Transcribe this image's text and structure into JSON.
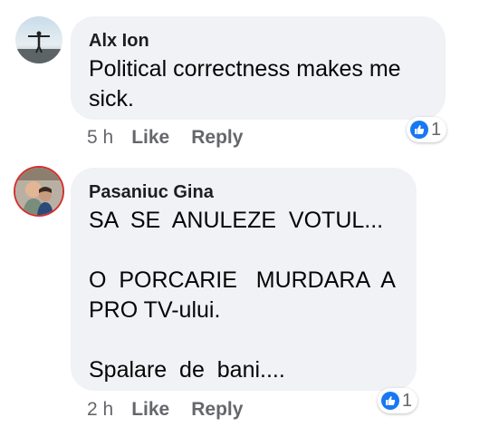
{
  "comments": [
    {
      "author": "Alx Ion",
      "text": "Political correctness makes me\nsick.",
      "time": "5 h",
      "like_label": "Like",
      "reply_label": "Reply",
      "reaction_count": "1"
    },
    {
      "author": "Pasaniuc Gina",
      "text": "SA  SE  ANULEZE  VOTUL...\n\nO  PORCARIE   MURDARA  A\nPRO TV-ului.\n\nSpalare  de  bani....",
      "time": "2 h",
      "like_label": "Like",
      "reply_label": "Reply",
      "reaction_count": "1"
    }
  ],
  "colors": {
    "bubble": "#f0f2f5",
    "meta_text": "#65676b",
    "like_blue": "#1877f2"
  },
  "icons": {
    "reaction": "thumbs-up-icon"
  }
}
